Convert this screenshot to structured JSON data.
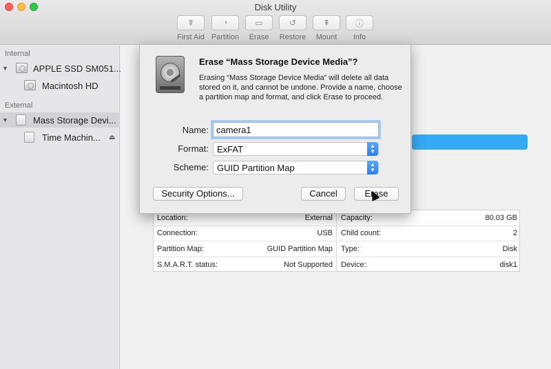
{
  "window": {
    "title": "Disk Utility"
  },
  "toolbar": [
    {
      "label": "First Aid",
      "icon": "stethoscope-icon"
    },
    {
      "label": "Partition",
      "icon": "pie-chart-icon"
    },
    {
      "label": "Erase",
      "icon": "erase-icon"
    },
    {
      "label": "Restore",
      "icon": "restore-icon"
    },
    {
      "label": "Mount",
      "icon": "mount-icon"
    },
    {
      "label": "Info",
      "icon": "info-icon"
    }
  ],
  "sidebar": {
    "internal_label": "Internal",
    "external_label": "External",
    "items": [
      {
        "label": "APPLE SSD SM051...",
        "type": "disk"
      },
      {
        "label": "Macintosh HD",
        "type": "volume"
      },
      {
        "label": "Mass Storage Devi...",
        "type": "disk",
        "selected": true
      },
      {
        "label": "Time Machin...",
        "type": "volume"
      }
    ]
  },
  "dialog": {
    "title": "Erase “Mass Storage Device Media”?",
    "message": "Erasing “Mass Storage Device Media” will delete all data stored on it, and cannot be undone. Provide a name, choose a partition map and format, and click Erase to proceed.",
    "name_label": "Name:",
    "name_value": "camera1",
    "format_label": "Format:",
    "format_value": "ExFAT",
    "scheme_label": "Scheme:",
    "scheme_value": "GUID Partition Map",
    "security_button": "Security Options...",
    "cancel_button": "Cancel",
    "erase_button": "Erase"
  },
  "info": {
    "left": [
      {
        "label": "Location:",
        "value": "External"
      },
      {
        "label": "Connection:",
        "value": "USB"
      },
      {
        "label": "Partition Map:",
        "value": "GUID Partition Map"
      },
      {
        "label": "S.M.A.R.T. status:",
        "value": "Not Supported"
      }
    ],
    "right": [
      {
        "label": "Capacity:",
        "value": "80.03 GB"
      },
      {
        "label": "Child count:",
        "value": "2"
      },
      {
        "label": "Type:",
        "value": "Disk"
      },
      {
        "label": "Device:",
        "value": "disk1"
      }
    ]
  },
  "colors": {
    "accent": "#34aaf3",
    "select_blue": "#2a7ff0"
  }
}
